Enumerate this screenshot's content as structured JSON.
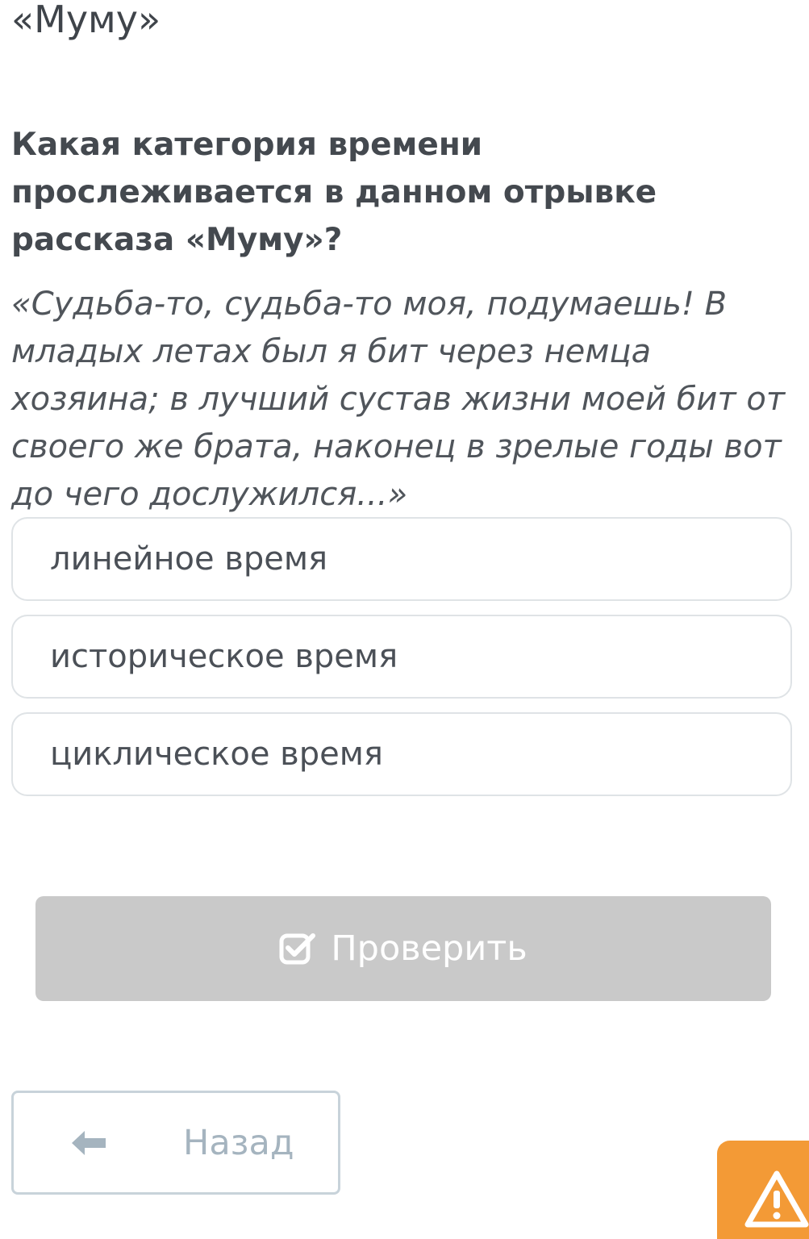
{
  "header": {
    "title": "«Муму»"
  },
  "question": {
    "text": "Какая категория времени прослеживается в данном отрывке рассказа «Муму»?",
    "quote": "«Судьба-то, судьба-то моя, подумаешь! В младых летах был я бит через немца хозяина; в лучший сустав жизни моей бит от своего же брата, наконец в зрелые годы вот до чего дослужился...»"
  },
  "options": [
    {
      "label": "линейное время"
    },
    {
      "label": "историческое время"
    },
    {
      "label": "циклическое время"
    }
  ],
  "actions": {
    "check_label": "Проверить",
    "back_label": "Назад"
  },
  "icons": {
    "check": "checkbox-check-icon",
    "back": "arrow-left-icon",
    "report": "warning-triangle-icon"
  },
  "colors": {
    "check_button_bg": "#c9c9c9",
    "report_button_bg": "#f39a36",
    "back_button_text": "#a5b4bf",
    "option_border": "#dfe3e6"
  }
}
